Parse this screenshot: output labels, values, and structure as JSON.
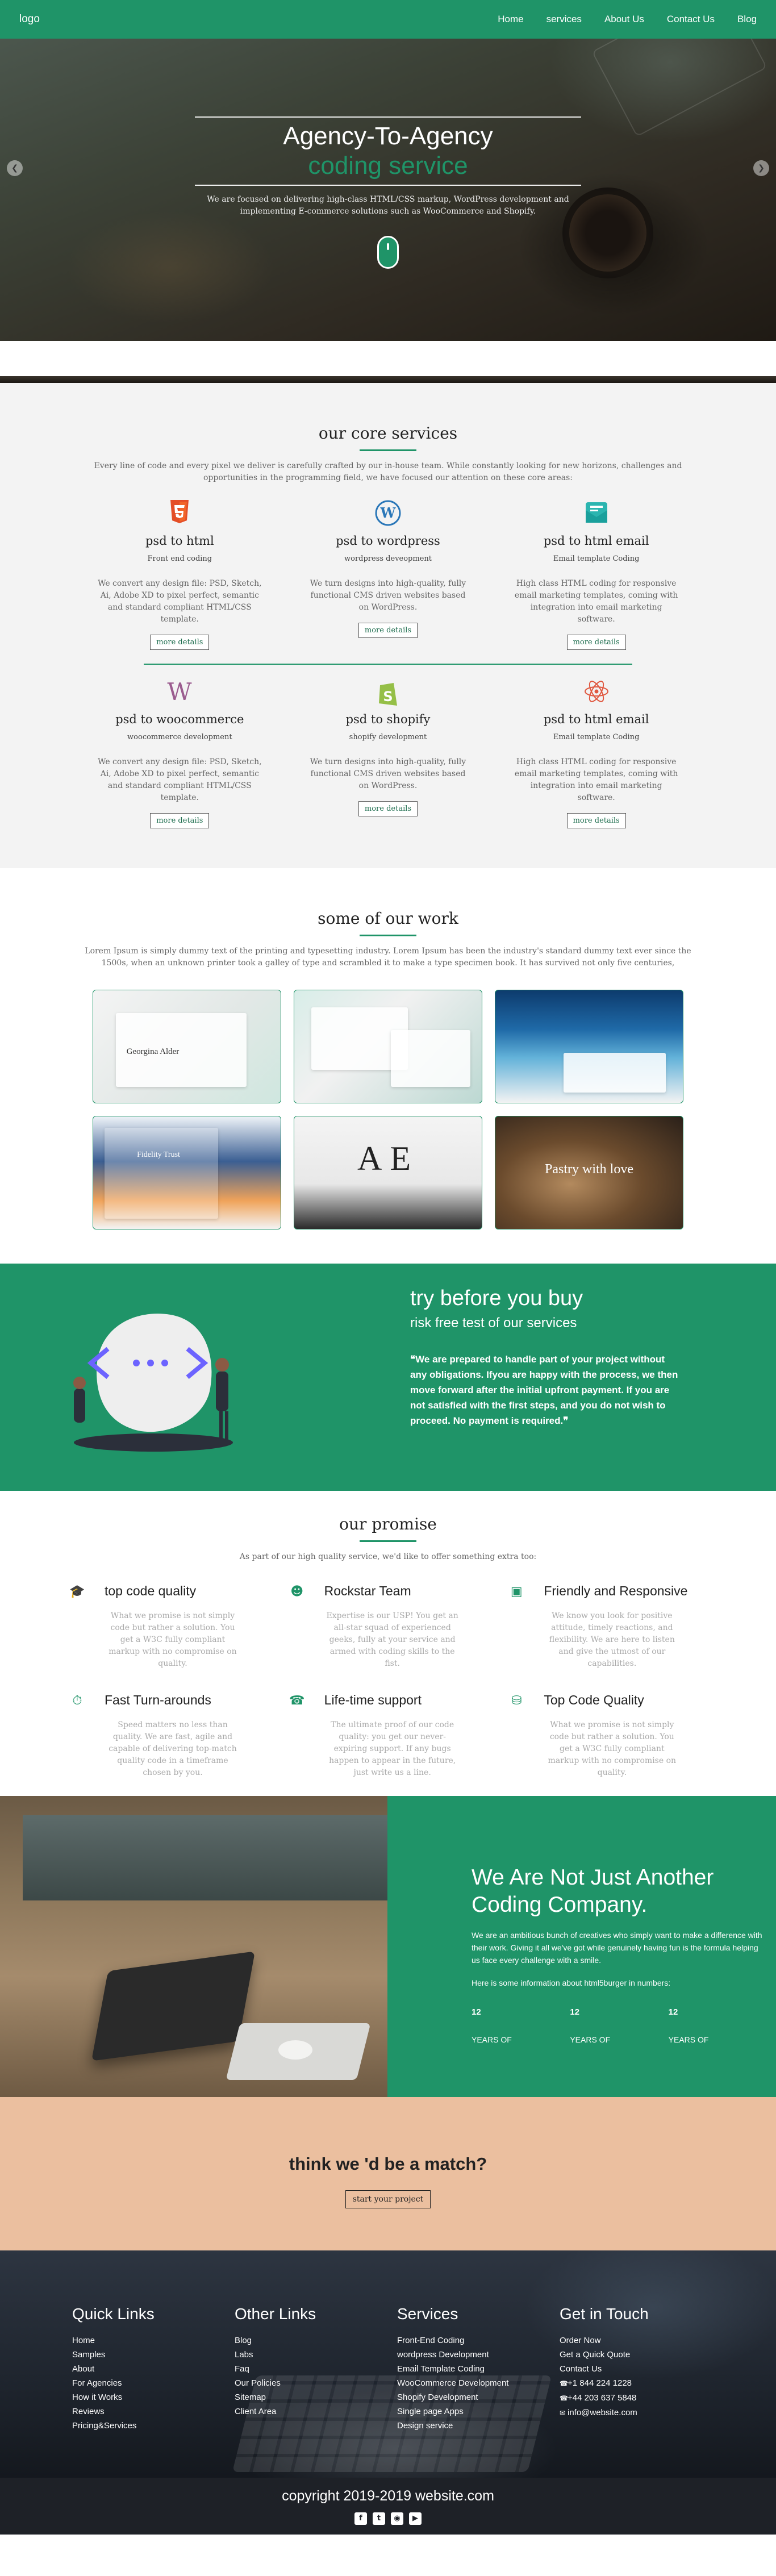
{
  "nav": {
    "logo": "logo",
    "items": [
      "Home",
      "services",
      "About Us",
      "Contact Us",
      "Blog"
    ]
  },
  "hero": {
    "title": "Agency-To-Agency",
    "subtitle": "coding service",
    "text": "We are focused on delivering high-class HTML/CSS markup, WordPress development and implementing E-commerce solutions such as WooCommerce and Shopify."
  },
  "core": {
    "title": "our core services",
    "intro": "Every line of code and every pixel we deliver is carefully crafted by our in-house team. While constantly looking for new horizons, challenges and opportunities in the programming field, we have focused our attention on these core areas:",
    "services": [
      {
        "title": "psd to html",
        "sub": "Front end coding",
        "text": "We convert any design file: PSD, Sketch, Ai, Adobe XD to pixel perfect, semantic and standard compliant HTML/CSS template.",
        "button": "more details"
      },
      {
        "title": "psd to wordpress",
        "sub": "wordpress deveopment",
        "text": "We turn designs into high-quality, fully functional CMS driven websites based on WordPress.",
        "button": "more details"
      },
      {
        "title": "psd to html email",
        "sub": "Email template Coding",
        "text": "High class HTML coding for responsive email marketing templates, coming with integration into email marketing software.",
        "button": "more details"
      },
      {
        "title": "psd to woocommerce",
        "sub": "woocommerce development",
        "text": "We convert any design file: PSD, Sketch, Ai, Adobe XD to pixel perfect, semantic and standard compliant HTML/CSS template.",
        "button": "more details"
      },
      {
        "title": "psd to shopify",
        "sub": "shopify development",
        "text": "We turn designs into high-quality, fully functional CMS driven websites based on WordPress.",
        "button": "more details"
      },
      {
        "title": "psd to html email",
        "sub": "Email template Coding",
        "text": "High class HTML coding for responsive email marketing templates, coming with integration into email marketing software.",
        "button": "more details"
      }
    ]
  },
  "work": {
    "title": "some of our work",
    "intro": "Lorem Ipsum is simply dummy text of the printing and typesetting industry. Lorem Ipsum has been the industry's standard dummy text ever since the 1500s, when an unknown printer took a galley of type and scrambled it to make a type specimen book. It has survived not only five centuries,",
    "item1_caption": "Georgina Alder",
    "item4_caption": "Fidelity Trust",
    "item6_caption": "Pastry with love"
  },
  "try": {
    "title": "try before you buy",
    "subtitle": "risk free test of our services",
    "text": "We are prepared to handle part of your project without any obligations. Ifyou are happy with the process, we then move forward after the initial upfront payment. If you are not satisfied with the first steps, and you do not wish to proceed. No payment is required."
  },
  "promise": {
    "title": "our promise",
    "intro": "As part of our high quality service, we'd like to offer something extra too:",
    "items": [
      {
        "title": "top code quality",
        "text": "What we promise is not simply code but rather a solution. You get a W3C fully compliant markup with no compromise on quality."
      },
      {
        "title": "Rockstar Team",
        "text": "Expertise is our USP! You get an all-star squad of experienced geeks, fully at your service and armed with coding skills to the fist."
      },
      {
        "title": "Friendly and Responsive",
        "text": "We know you look for positive attitude, timely reactions, and flexibility. We are here to listen and give the utmost of our capabilities."
      },
      {
        "title": "Fast Turn-arounds",
        "text": "Speed matters no less than quality. We are fast, agile and capable of delivering top-match quality code in a timeframe chosen by you."
      },
      {
        "title": "Life-time support",
        "text": "The ultimate proof of our code quality: you get our never-expiring support. If any bugs happen to appear in the future, just write us a line."
      },
      {
        "title": "Top Code Quality",
        "text": "What we promise is not simply code but rather a solution. You get a W3C fully compliant markup with no compromise on quality."
      }
    ]
  },
  "agency": {
    "title": "We Are Not Just Another Coding Company.",
    "text": "We are an ambitious bunch of creatives who simply want to make a difference with their work. Giving it all we've got while genuinely having fun is the formula helping us face every challenge with a smile.",
    "numbers_intro": "Here is some information about html5burger in numbers:",
    "stats": [
      {
        "num": "12",
        "label": "YEARS OF"
      },
      {
        "num": "12",
        "label": "YEARS OF"
      },
      {
        "num": "12",
        "label": "YEARS OF"
      }
    ]
  },
  "match": {
    "title": "think we 'd be a match?",
    "button": "start your project"
  },
  "footer": {
    "cols": [
      {
        "title": "Quick Links",
        "links": [
          "Home",
          "Samples",
          "About",
          "For Agencies",
          "How it Works",
          "Reviews",
          "Pricing&Services"
        ]
      },
      {
        "title": "Other Links",
        "links": [
          "Blog",
          "Labs",
          "Faq",
          "Our Policies",
          "Sitemap",
          "Client Area"
        ]
      },
      {
        "title": "Services",
        "links": [
          "Front-End Coding",
          "wordpress Development",
          "Email Template Coding",
          "WooCommerce Development",
          "Shopify Development",
          "Single page Apps",
          "Design service"
        ]
      },
      {
        "title": "Get in Touch",
        "links": [
          "Order Now",
          "Get a Quick Quote",
          "Contact Us",
          "+1 844 224 1228",
          "+44 203 637 5848",
          "info@website.com"
        ]
      }
    ],
    "copyright": "copyright 2019-2019 website.com"
  }
}
